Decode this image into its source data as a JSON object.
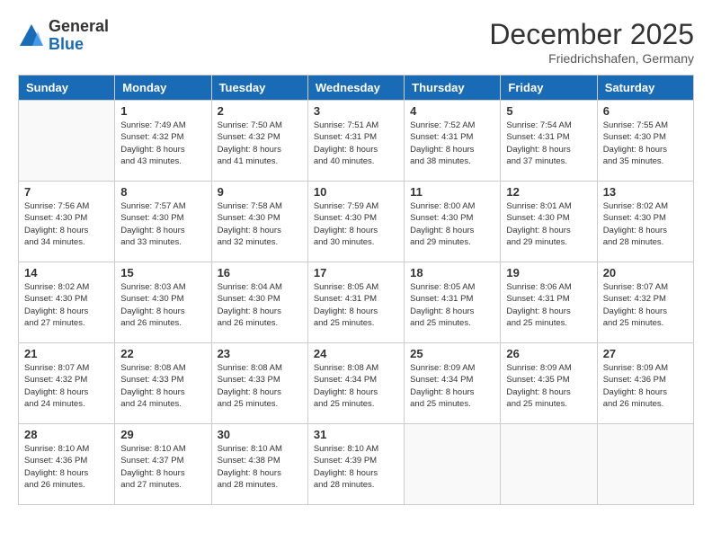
{
  "logo": {
    "general": "General",
    "blue": "Blue"
  },
  "title": "December 2025",
  "location": "Friedrichshafen, Germany",
  "days_header": [
    "Sunday",
    "Monday",
    "Tuesday",
    "Wednesday",
    "Thursday",
    "Friday",
    "Saturday"
  ],
  "weeks": [
    [
      {
        "num": "",
        "info": ""
      },
      {
        "num": "1",
        "info": "Sunrise: 7:49 AM\nSunset: 4:32 PM\nDaylight: 8 hours\nand 43 minutes."
      },
      {
        "num": "2",
        "info": "Sunrise: 7:50 AM\nSunset: 4:32 PM\nDaylight: 8 hours\nand 41 minutes."
      },
      {
        "num": "3",
        "info": "Sunrise: 7:51 AM\nSunset: 4:31 PM\nDaylight: 8 hours\nand 40 minutes."
      },
      {
        "num": "4",
        "info": "Sunrise: 7:52 AM\nSunset: 4:31 PM\nDaylight: 8 hours\nand 38 minutes."
      },
      {
        "num": "5",
        "info": "Sunrise: 7:54 AM\nSunset: 4:31 PM\nDaylight: 8 hours\nand 37 minutes."
      },
      {
        "num": "6",
        "info": "Sunrise: 7:55 AM\nSunset: 4:30 PM\nDaylight: 8 hours\nand 35 minutes."
      }
    ],
    [
      {
        "num": "7",
        "info": "Sunrise: 7:56 AM\nSunset: 4:30 PM\nDaylight: 8 hours\nand 34 minutes."
      },
      {
        "num": "8",
        "info": "Sunrise: 7:57 AM\nSunset: 4:30 PM\nDaylight: 8 hours\nand 33 minutes."
      },
      {
        "num": "9",
        "info": "Sunrise: 7:58 AM\nSunset: 4:30 PM\nDaylight: 8 hours\nand 32 minutes."
      },
      {
        "num": "10",
        "info": "Sunrise: 7:59 AM\nSunset: 4:30 PM\nDaylight: 8 hours\nand 30 minutes."
      },
      {
        "num": "11",
        "info": "Sunrise: 8:00 AM\nSunset: 4:30 PM\nDaylight: 8 hours\nand 29 minutes."
      },
      {
        "num": "12",
        "info": "Sunrise: 8:01 AM\nSunset: 4:30 PM\nDaylight: 8 hours\nand 29 minutes."
      },
      {
        "num": "13",
        "info": "Sunrise: 8:02 AM\nSunset: 4:30 PM\nDaylight: 8 hours\nand 28 minutes."
      }
    ],
    [
      {
        "num": "14",
        "info": "Sunrise: 8:02 AM\nSunset: 4:30 PM\nDaylight: 8 hours\nand 27 minutes."
      },
      {
        "num": "15",
        "info": "Sunrise: 8:03 AM\nSunset: 4:30 PM\nDaylight: 8 hours\nand 26 minutes."
      },
      {
        "num": "16",
        "info": "Sunrise: 8:04 AM\nSunset: 4:30 PM\nDaylight: 8 hours\nand 26 minutes."
      },
      {
        "num": "17",
        "info": "Sunrise: 8:05 AM\nSunset: 4:31 PM\nDaylight: 8 hours\nand 25 minutes."
      },
      {
        "num": "18",
        "info": "Sunrise: 8:05 AM\nSunset: 4:31 PM\nDaylight: 8 hours\nand 25 minutes."
      },
      {
        "num": "19",
        "info": "Sunrise: 8:06 AM\nSunset: 4:31 PM\nDaylight: 8 hours\nand 25 minutes."
      },
      {
        "num": "20",
        "info": "Sunrise: 8:07 AM\nSunset: 4:32 PM\nDaylight: 8 hours\nand 25 minutes."
      }
    ],
    [
      {
        "num": "21",
        "info": "Sunrise: 8:07 AM\nSunset: 4:32 PM\nDaylight: 8 hours\nand 24 minutes."
      },
      {
        "num": "22",
        "info": "Sunrise: 8:08 AM\nSunset: 4:33 PM\nDaylight: 8 hours\nand 24 minutes."
      },
      {
        "num": "23",
        "info": "Sunrise: 8:08 AM\nSunset: 4:33 PM\nDaylight: 8 hours\nand 25 minutes."
      },
      {
        "num": "24",
        "info": "Sunrise: 8:08 AM\nSunset: 4:34 PM\nDaylight: 8 hours\nand 25 minutes."
      },
      {
        "num": "25",
        "info": "Sunrise: 8:09 AM\nSunset: 4:34 PM\nDaylight: 8 hours\nand 25 minutes."
      },
      {
        "num": "26",
        "info": "Sunrise: 8:09 AM\nSunset: 4:35 PM\nDaylight: 8 hours\nand 25 minutes."
      },
      {
        "num": "27",
        "info": "Sunrise: 8:09 AM\nSunset: 4:36 PM\nDaylight: 8 hours\nand 26 minutes."
      }
    ],
    [
      {
        "num": "28",
        "info": "Sunrise: 8:10 AM\nSunset: 4:36 PM\nDaylight: 8 hours\nand 26 minutes."
      },
      {
        "num": "29",
        "info": "Sunrise: 8:10 AM\nSunset: 4:37 PM\nDaylight: 8 hours\nand 27 minutes."
      },
      {
        "num": "30",
        "info": "Sunrise: 8:10 AM\nSunset: 4:38 PM\nDaylight: 8 hours\nand 28 minutes."
      },
      {
        "num": "31",
        "info": "Sunrise: 8:10 AM\nSunset: 4:39 PM\nDaylight: 8 hours\nand 28 minutes."
      },
      {
        "num": "",
        "info": ""
      },
      {
        "num": "",
        "info": ""
      },
      {
        "num": "",
        "info": ""
      }
    ]
  ]
}
